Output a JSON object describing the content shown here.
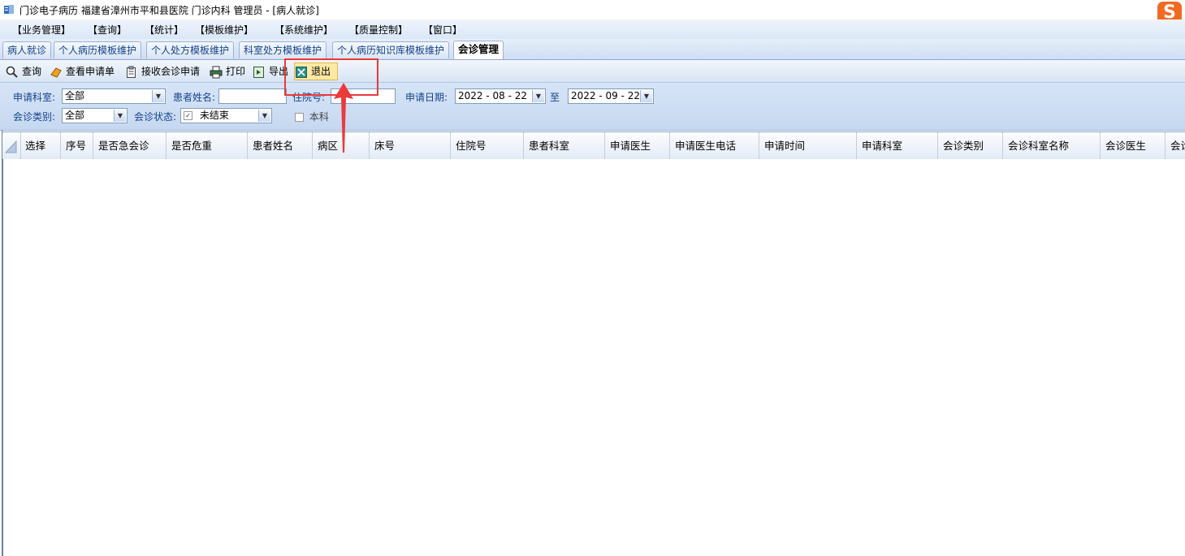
{
  "window": {
    "title": "门诊电子病历  福建省漳州市平和县医院  门诊内科  管理员 - [病人就诊]",
    "ime_logo": "S"
  },
  "menu": [
    "【业务管理】",
    "【查询】",
    "【统计】",
    "【模板维护】",
    "【系统维护】",
    "【质量控制】",
    "【窗口】"
  ],
  "tabs": [
    "病人就诊",
    "个人病历模板维护",
    "个人处方模板维护",
    "科室处方模板维护",
    "个人病历知识库模板维护",
    "会诊管理"
  ],
  "active_tab": "会诊管理",
  "toolbar": {
    "query": "查询",
    "view_request": "查看申请单",
    "receive": "接收会诊申请",
    "print": "打印",
    "export": "导出",
    "exit": "退出"
  },
  "filters": {
    "dept_label": "申请科室:",
    "dept_value": "全部",
    "patient_label": "患者姓名:",
    "patient_value": "",
    "inpatient_label": "住院号:",
    "inpatient_value": "",
    "date_label": "申请日期:",
    "date_from": "2022 - 08 - 22",
    "date_to_label": "至",
    "date_to": "2022 - 09 - 22",
    "type_label": "会诊类别:",
    "type_value": "全部",
    "status_label": "会诊状态:",
    "status_value": "未结束",
    "own_dept_label": "本科"
  },
  "grid": {
    "columns": [
      "选择",
      "序号",
      "是否急会诊",
      "是否危重",
      "患者姓名",
      "病区",
      "床号",
      "住院号",
      "患者科室",
      "申请医生",
      "申请医生电话",
      "申请时间",
      "申请科室",
      "会诊类别",
      "会诊科室名称",
      "会诊医生",
      "会诊"
    ],
    "rows": []
  },
  "colors": {
    "highlight": "#ea3a3a",
    "accent": "#15428b"
  }
}
